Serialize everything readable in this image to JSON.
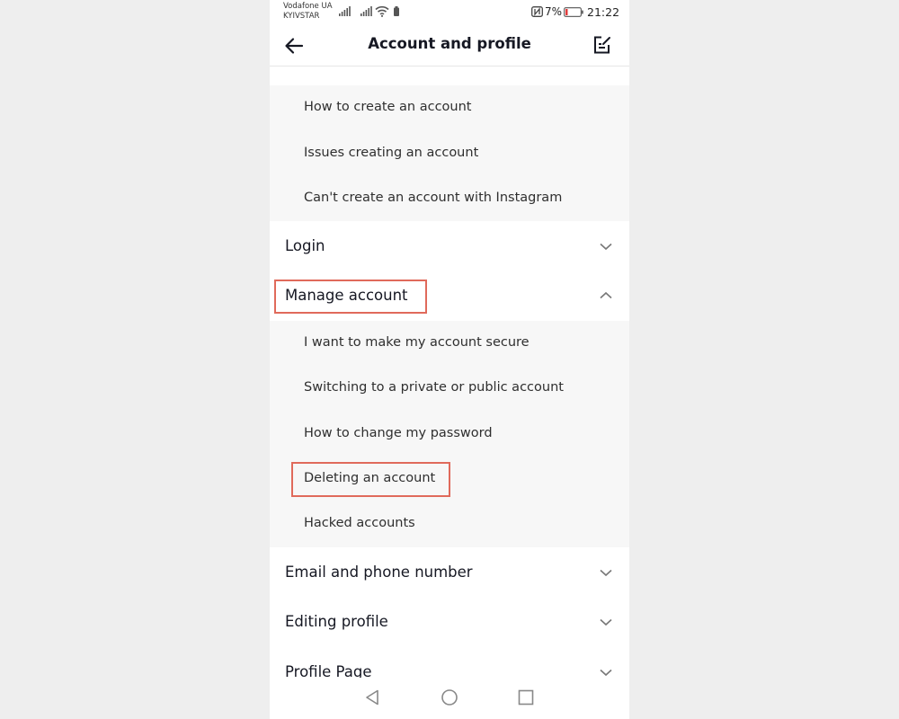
{
  "status_bar": {
    "carrier_line1": "Vodafone UA",
    "carrier_line2": "KYIVSTAR",
    "battery_percent": "7%",
    "time": "21:22",
    "icons": [
      "signal-icon",
      "signal-icon",
      "wifi-icon",
      "battery-saver-icon",
      "nfc-icon",
      "battery-icon"
    ]
  },
  "header": {
    "title": "Account and profile",
    "back_icon": "arrow-left-icon",
    "feedback_icon": "edit-note-icon"
  },
  "sections": {
    "create_account": {
      "items": [
        "How to create an account",
        "Issues creating an account",
        "Can't create an account with Instagram"
      ]
    },
    "login": {
      "label": "Login",
      "expanded": false
    },
    "manage_account": {
      "label": "Manage account",
      "expanded": true,
      "items": [
        "I want to make my account secure",
        "Switching to a private or public account",
        "How to change my password",
        "Deleting an account",
        "Hacked accounts"
      ]
    },
    "email_phone": {
      "label": "Email and phone number",
      "expanded": false
    },
    "editing_profile": {
      "label": "Editing profile",
      "expanded": false
    },
    "profile_page": {
      "label": "Profile Page",
      "expanded": false
    }
  },
  "colors": {
    "highlight": "#e06a5b",
    "sub_list_bg": "#f7f7f7",
    "page_bg": "#eeeeee"
  },
  "nav_bar": {
    "icons": [
      "nav-back-icon",
      "nav-home-icon",
      "nav-recents-icon"
    ]
  }
}
